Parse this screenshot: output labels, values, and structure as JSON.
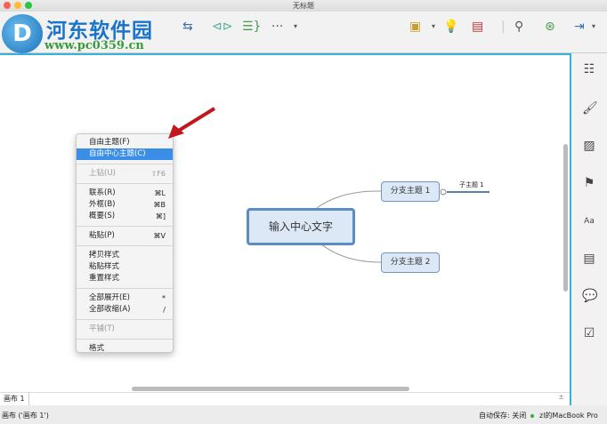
{
  "window": {
    "title": "无标题"
  },
  "watermark": {
    "name": "河东软件园",
    "url": "www.pc0359.cn"
  },
  "toolbar": {
    "more": "···"
  },
  "mindmap": {
    "central": "输入中心文字",
    "branches": [
      "分支主题 1",
      "分支主题 2"
    ],
    "subtopic": "子主题 1"
  },
  "context_menu": {
    "items": [
      {
        "label": "自由主题(F)",
        "shortcut": ""
      },
      {
        "label": "自由中心主题(C)",
        "shortcut": "",
        "highlighted": true
      },
      {
        "label": "上钻(U)",
        "shortcut": "⇧F6",
        "disabled": true
      },
      {
        "label": "联系(R)",
        "shortcut": "⌘L"
      },
      {
        "label": "外框(B)",
        "shortcut": "⌘B"
      },
      {
        "label": "概要(S)",
        "shortcut": "⌘]"
      },
      {
        "label": "粘贴(P)",
        "shortcut": "⌘V"
      },
      {
        "label": "拷贝样式",
        "shortcut": ""
      },
      {
        "label": "粘贴样式",
        "shortcut": ""
      },
      {
        "label": "重置样式",
        "shortcut": ""
      },
      {
        "label": "全部展开(E)",
        "shortcut": "*"
      },
      {
        "label": "全部收缩(A)",
        "shortcut": "/"
      },
      {
        "label": "平铺(T)",
        "shortcut": "",
        "disabled": true
      },
      {
        "label": "格式",
        "shortcut": ""
      }
    ]
  },
  "sheet_tab": "画布 1",
  "status": {
    "left": "画布 ('画布 1')",
    "autosave": "自动保存: 关闭",
    "device": "zl的MacBook Pro"
  }
}
